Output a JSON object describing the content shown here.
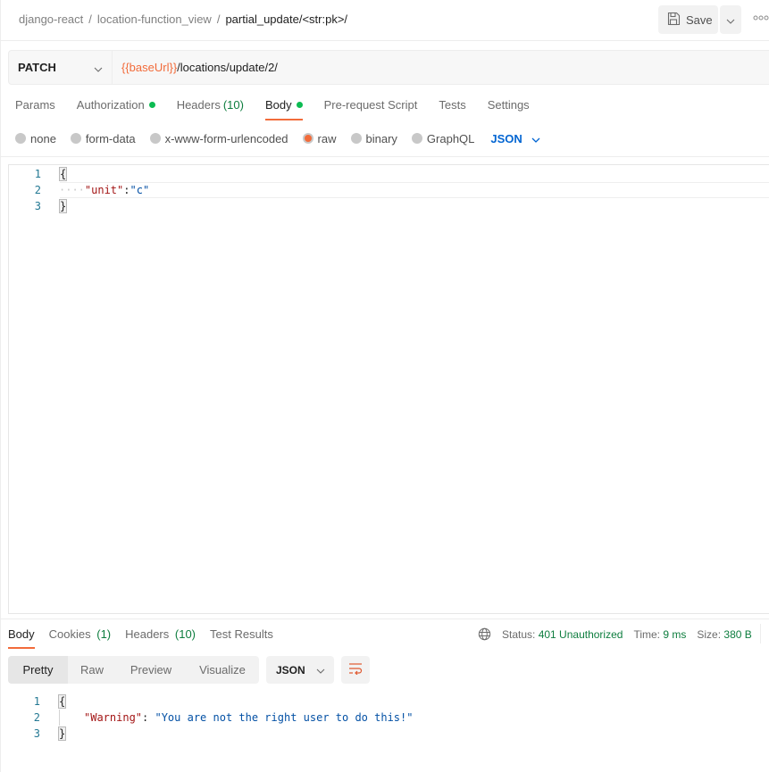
{
  "breadcrumb": {
    "items": [
      "django-react",
      "location-function_view"
    ],
    "current": "partial_update/<str:pk>/",
    "separator": "/"
  },
  "toolbar": {
    "save_label": "Save",
    "save_icon": "floppy-disk-icon",
    "more_icon": "ellipsis-icon"
  },
  "request": {
    "method": "PATCH",
    "url_variable": "{{baseUrl}}",
    "url_path": "/locations/update/2/"
  },
  "request_tabs": [
    {
      "label": "Params",
      "count": null,
      "dot": false,
      "active": false
    },
    {
      "label": "Authorization",
      "count": null,
      "dot": true,
      "active": false
    },
    {
      "label": "Headers",
      "count": "(10)",
      "dot": false,
      "active": false
    },
    {
      "label": "Body",
      "count": null,
      "dot": true,
      "active": true
    },
    {
      "label": "Pre-request Script",
      "count": null,
      "dot": false,
      "active": false
    },
    {
      "label": "Tests",
      "count": null,
      "dot": false,
      "active": false
    },
    {
      "label": "Settings",
      "count": null,
      "dot": false,
      "active": false
    }
  ],
  "body_types": {
    "options": [
      "none",
      "form-data",
      "x-www-form-urlencoded",
      "raw",
      "binary",
      "GraphQL"
    ],
    "selected": "raw",
    "language": "JSON"
  },
  "request_body": {
    "line_numbers": [
      "1",
      "2",
      "3"
    ],
    "open_brace": "{",
    "whitespace": "····",
    "key": "\"unit\"",
    "colon": ":",
    "value": "\"c\"",
    "close_brace": "}"
  },
  "response_tabs": [
    {
      "label": "Body",
      "count": null,
      "active": true
    },
    {
      "label": "Cookies",
      "count": "(1)",
      "active": false
    },
    {
      "label": "Headers",
      "count": "(10)",
      "active": false
    },
    {
      "label": "Test Results",
      "count": null,
      "active": false
    }
  ],
  "response_status": {
    "status_label": "Status:",
    "status_value": "401 Unauthorized",
    "time_label": "Time:",
    "time_value": "9 ms",
    "size_label": "Size:",
    "size_value": "380 B"
  },
  "response_view": {
    "modes": [
      "Pretty",
      "Raw",
      "Preview",
      "Visualize"
    ],
    "selected": "Pretty",
    "language": "JSON",
    "wrap_icon": "wrap-lines-icon"
  },
  "response_body": {
    "line_numbers": [
      "1",
      "2",
      "3"
    ],
    "open_brace": "{",
    "key": "\"Warning\"",
    "colon": ": ",
    "value": "\"You are not the right user to do this!\"",
    "close_brace": "}"
  },
  "colors": {
    "accent": "#f26b3a",
    "success": "#0d7d3e",
    "dot": "#0cbb52",
    "link_blue": "#0265d2"
  }
}
